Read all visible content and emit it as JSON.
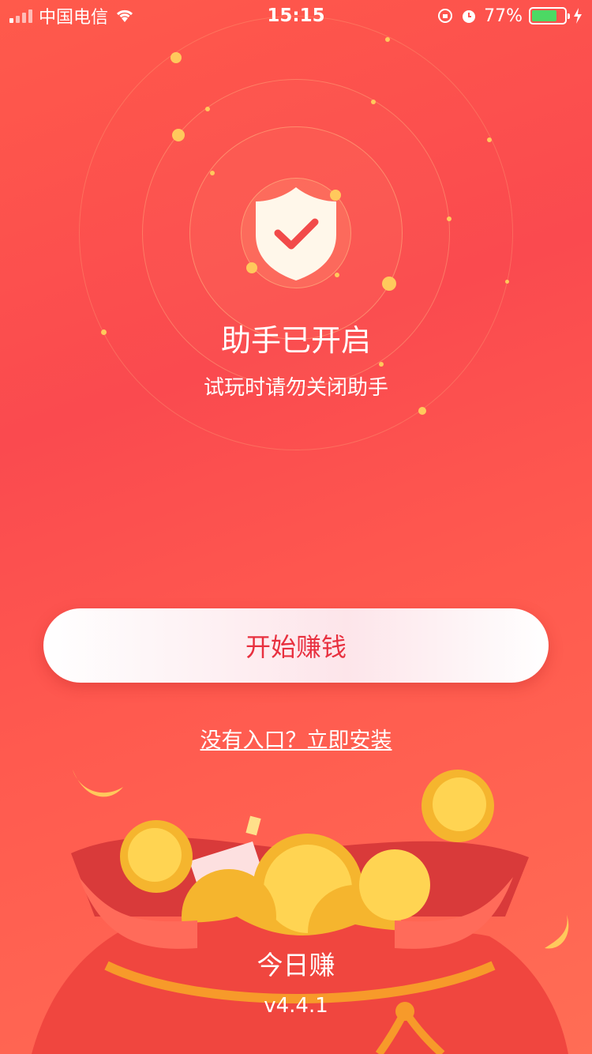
{
  "status_bar": {
    "carrier": "中国电信",
    "time": "15:15",
    "battery_percent": "77%",
    "battery_level": 0.77,
    "icons": [
      "signal-icon",
      "wifi-icon",
      "rotation-lock-icon",
      "alarm-icon",
      "battery-icon",
      "charging-icon"
    ]
  },
  "hero": {
    "icon": "shield-check-icon",
    "title": "助手已开启",
    "subtitle": "试玩时请勿关闭助手"
  },
  "actions": {
    "start_label": "开始赚钱",
    "install_link": "没有入口？立即安装"
  },
  "footer": {
    "app_name": "今日赚",
    "version": "v4.4.1"
  },
  "colors": {
    "background": "#ff5a4f",
    "accent_text": "#e8303f",
    "gold": "#ffc95c",
    "battery_fill": "#4cd964"
  }
}
